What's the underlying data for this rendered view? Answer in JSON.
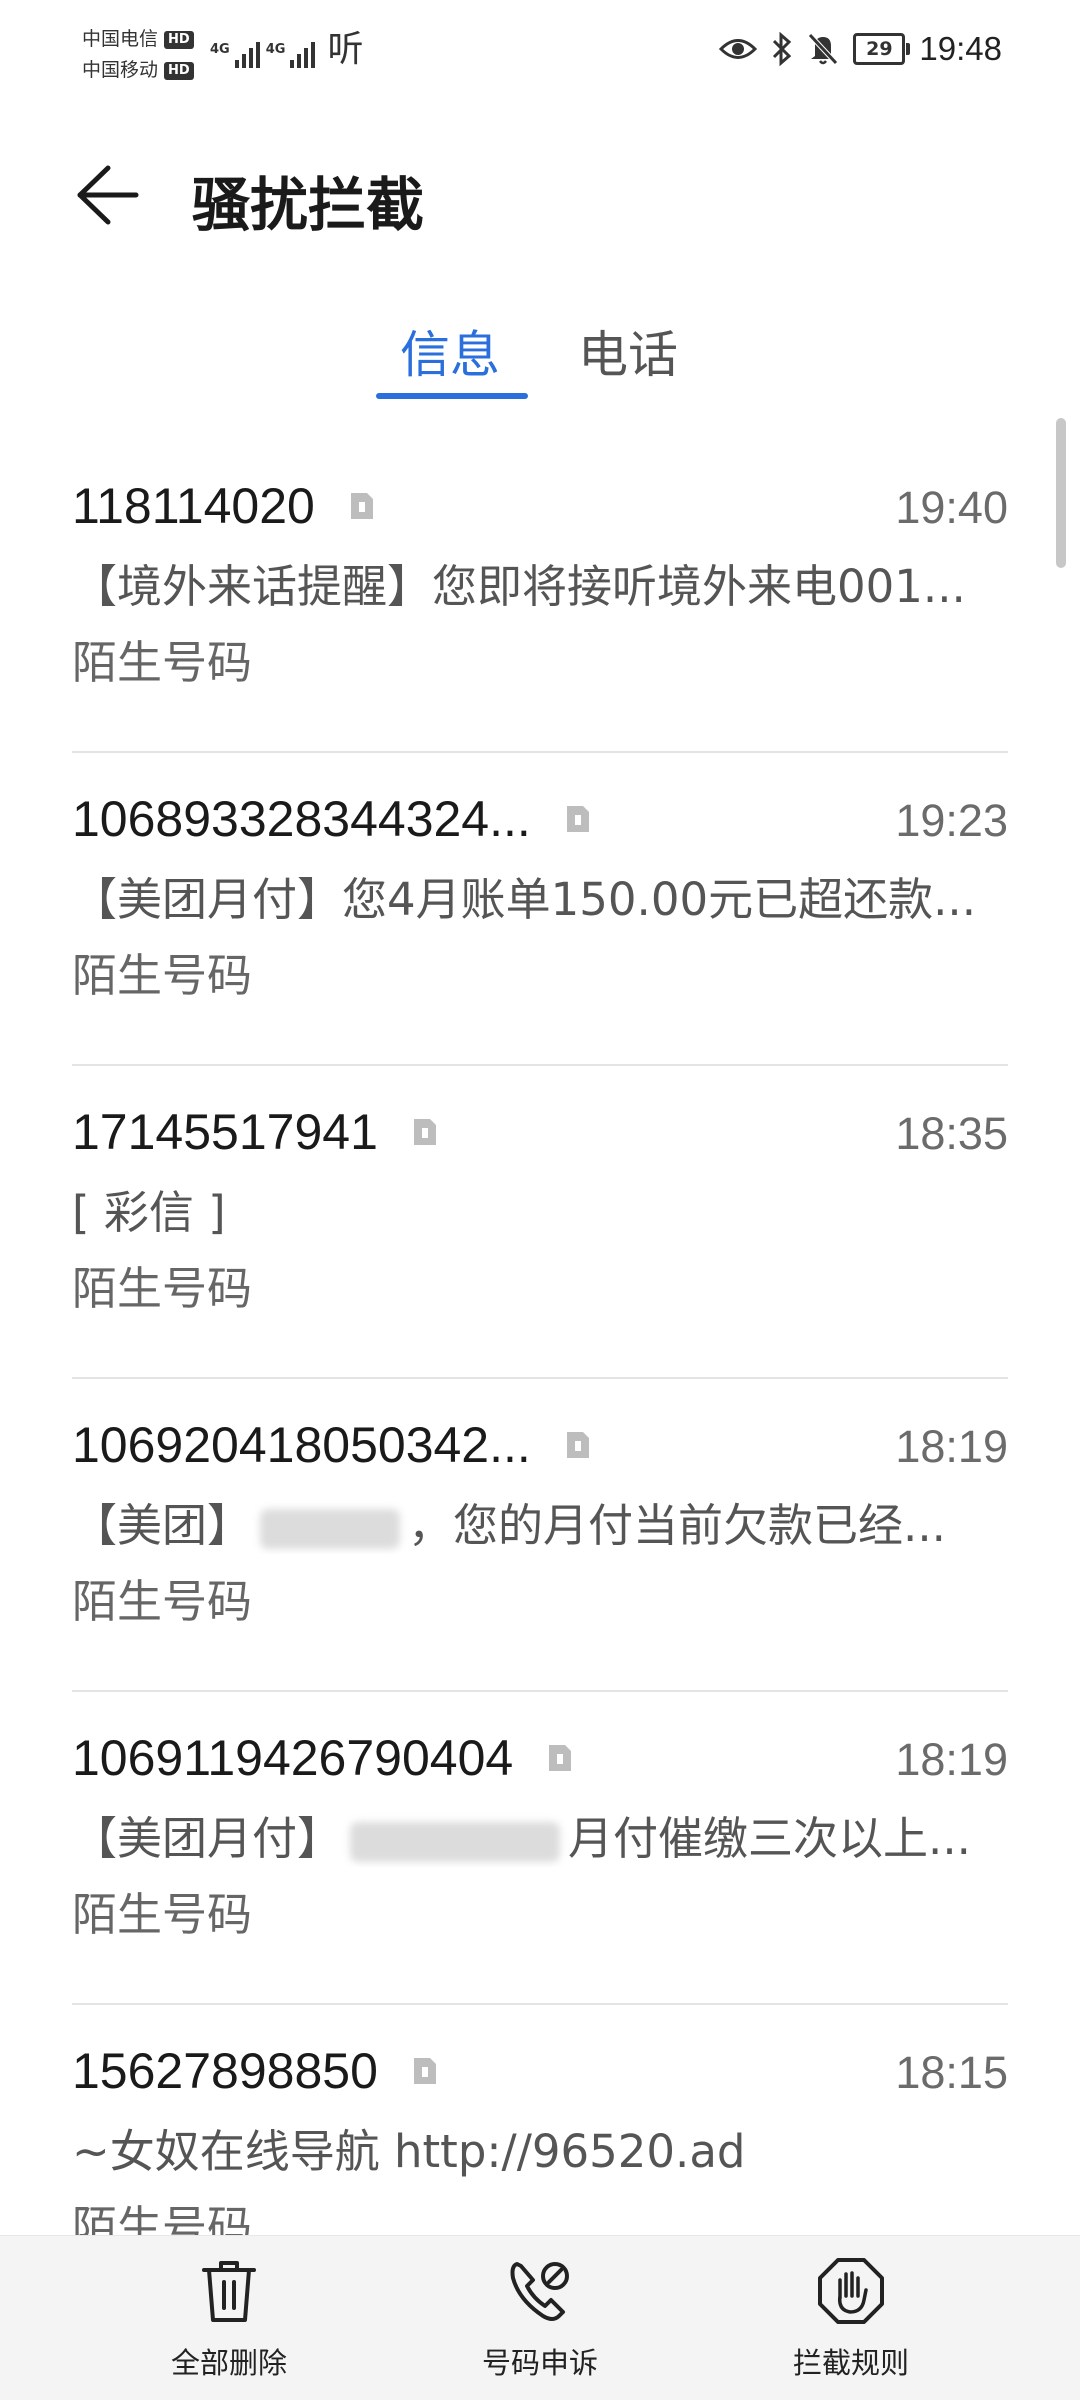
{
  "status_bar": {
    "carrier1": "中国电信",
    "carrier2": "中国移动",
    "hd": "HD",
    "network": "4G",
    "app_label": "听",
    "battery": "29",
    "time": "19:48"
  },
  "header": {
    "title": "骚扰拦截"
  },
  "tabs": [
    {
      "label": "信息",
      "active": true
    },
    {
      "label": "电话",
      "active": false
    }
  ],
  "messages": [
    {
      "sender": "118114020",
      "time": "19:40",
      "preview": "【境外来话提醒】您即将接听境外来电001...",
      "label": "陌生号码"
    },
    {
      "sender": "106893328344324...",
      "time": "19:23",
      "preview": "【美团月付】您4月账单150.00元已超还款...",
      "label": "陌生号码"
    },
    {
      "sender": "17145517941",
      "time": "18:35",
      "preview": "[ 彩信 ]",
      "label": "陌生号码"
    },
    {
      "sender": "106920418050342...",
      "time": "18:19",
      "preview_start": "【美团】",
      "preview_end": "，您的月付当前欠款已经...",
      "label": "陌生号码"
    },
    {
      "sender": "1069119426790404",
      "time": "18:19",
      "preview_start": "【美团月付】",
      "preview_end": "月付催缴三次以上...",
      "label": "陌生号码"
    },
    {
      "sender": "15627898850",
      "time": "18:15",
      "preview": "~女奴在线导航  http://96520.ad",
      "label": "陌生号码"
    }
  ],
  "bottom_bar": {
    "delete_all": "全部删除",
    "appeal": "号码申诉",
    "rules": "拦截规则"
  },
  "colors": {
    "accent": "#2a6fdb",
    "divider": "#e4e4e4",
    "bottom_bar_bg": "#f4f4f4"
  },
  "icons": {
    "back": "arrow-left-icon",
    "sim": "sim-card-icon",
    "delete": "trash-icon",
    "appeal": "phone-appeal-icon",
    "rules": "hand-stop-icon",
    "bluetooth": "bluetooth-icon",
    "eye": "eye-comfort-icon",
    "mute": "bell-off-icon"
  }
}
